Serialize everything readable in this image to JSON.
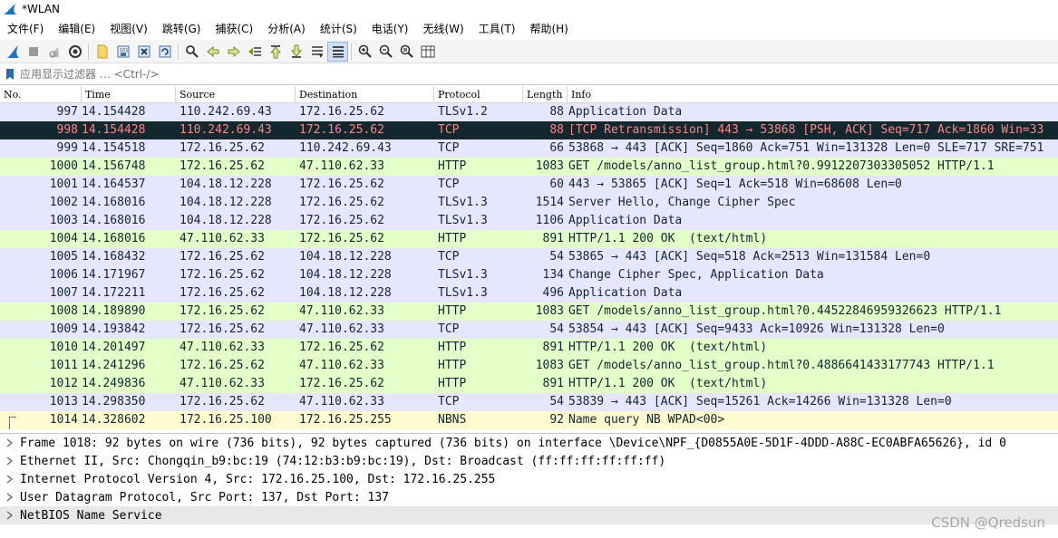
{
  "window": {
    "title": "*WLAN"
  },
  "menu": [
    "文件(F)",
    "编辑(E)",
    "视图(V)",
    "跳转(G)",
    "捕获(C)",
    "分析(A)",
    "统计(S)",
    "电话(Y)",
    "无线(W)",
    "工具(T)",
    "帮助(H)"
  ],
  "toolbar": {
    "icons": [
      "start-capture-icon",
      "stop-capture-icon",
      "restart-capture-icon",
      "capture-options-icon",
      "open-file-icon",
      "save-file-icon",
      "close-file-icon",
      "reload-file-icon",
      "find-packet-icon",
      "go-back-icon",
      "go-forward-icon",
      "go-to-packet-icon",
      "go-first-icon",
      "go-last-icon",
      "auto-scroll-icon",
      "colorize-icon",
      "zoom-in-icon",
      "zoom-out-icon",
      "normal-size-icon",
      "resize-columns-icon"
    ]
  },
  "filter": {
    "placeholder": "应用显示过滤器 … <Ctrl-/>"
  },
  "packet_list": {
    "columns": {
      "no": "No.",
      "time": "Time",
      "source": "Source",
      "destination": "Destination",
      "protocol": "Protocol",
      "length": "Length",
      "info": "Info"
    },
    "rows": [
      {
        "no": "997",
        "time": "14.154428",
        "source": "110.242.69.43",
        "destination": "172.16.25.62",
        "protocol": "TLSv1.2",
        "length": "88",
        "info": "Application Data",
        "bg": "#e7e6ff",
        "fg": "#12272e"
      },
      {
        "no": "998",
        "time": "14.154428",
        "source": "110.242.69.43",
        "destination": "172.16.25.62",
        "protocol": "TCP",
        "length": "88",
        "info": "[TCP Retransmission] 443 → 53868 [PSH, ACK] Seq=717 Ack=1860 Win=33",
        "bg": "#12272e",
        "fg": "#f78787"
      },
      {
        "no": "999",
        "time": "14.154518",
        "source": "172.16.25.62",
        "destination": "110.242.69.43",
        "protocol": "TCP",
        "length": "66",
        "info": "53868 → 443 [ACK] Seq=1860 Ack=751 Win=131328 Len=0 SLE=717 SRE=751",
        "bg": "#e7e6ff",
        "fg": "#12272e"
      },
      {
        "no": "1000",
        "time": "14.156748",
        "source": "172.16.25.62",
        "destination": "47.110.62.33",
        "protocol": "HTTP",
        "length": "1083",
        "info": "GET /models/anno_list_group.html?0.9912207303305052 HTTP/1.1",
        "bg": "#e4ffc7",
        "fg": "#12272e"
      },
      {
        "no": "1001",
        "time": "14.164537",
        "source": "104.18.12.228",
        "destination": "172.16.25.62",
        "protocol": "TCP",
        "length": "60",
        "info": "443 → 53865 [ACK] Seq=1 Ack=518 Win=68608 Len=0",
        "bg": "#e7e6ff",
        "fg": "#12272e"
      },
      {
        "no": "1002",
        "time": "14.168016",
        "source": "104.18.12.228",
        "destination": "172.16.25.62",
        "protocol": "TLSv1.3",
        "length": "1514",
        "info": "Server Hello, Change Cipher Spec",
        "bg": "#e7e6ff",
        "fg": "#12272e"
      },
      {
        "no": "1003",
        "time": "14.168016",
        "source": "104.18.12.228",
        "destination": "172.16.25.62",
        "protocol": "TLSv1.3",
        "length": "1106",
        "info": "Application Data",
        "bg": "#e7e6ff",
        "fg": "#12272e"
      },
      {
        "no": "1004",
        "time": "14.168016",
        "source": "47.110.62.33",
        "destination": "172.16.25.62",
        "protocol": "HTTP",
        "length": "891",
        "info": "HTTP/1.1 200 OK  (text/html)",
        "bg": "#e4ffc7",
        "fg": "#12272e"
      },
      {
        "no": "1005",
        "time": "14.168432",
        "source": "172.16.25.62",
        "destination": "104.18.12.228",
        "protocol": "TCP",
        "length": "54",
        "info": "53865 → 443 [ACK] Seq=518 Ack=2513 Win=131584 Len=0",
        "bg": "#e7e6ff",
        "fg": "#12272e"
      },
      {
        "no": "1006",
        "time": "14.171967",
        "source": "172.16.25.62",
        "destination": "104.18.12.228",
        "protocol": "TLSv1.3",
        "length": "134",
        "info": "Change Cipher Spec, Application Data",
        "bg": "#e7e6ff",
        "fg": "#12272e"
      },
      {
        "no": "1007",
        "time": "14.172211",
        "source": "172.16.25.62",
        "destination": "104.18.12.228",
        "protocol": "TLSv1.3",
        "length": "496",
        "info": "Application Data",
        "bg": "#e7e6ff",
        "fg": "#12272e"
      },
      {
        "no": "1008",
        "time": "14.189890",
        "source": "172.16.25.62",
        "destination": "47.110.62.33",
        "protocol": "HTTP",
        "length": "1083",
        "info": "GET /models/anno_list_group.html?0.44522846959326623 HTTP/1.1",
        "bg": "#e4ffc7",
        "fg": "#12272e"
      },
      {
        "no": "1009",
        "time": "14.193842",
        "source": "172.16.25.62",
        "destination": "47.110.62.33",
        "protocol": "TCP",
        "length": "54",
        "info": "53854 → 443 [ACK] Seq=9433 Ack=10926 Win=131328 Len=0",
        "bg": "#e7e6ff",
        "fg": "#12272e"
      },
      {
        "no": "1010",
        "time": "14.201497",
        "source": "47.110.62.33",
        "destination": "172.16.25.62",
        "protocol": "HTTP",
        "length": "891",
        "info": "HTTP/1.1 200 OK  (text/html)",
        "bg": "#e4ffc7",
        "fg": "#12272e"
      },
      {
        "no": "1011",
        "time": "14.241296",
        "source": "172.16.25.62",
        "destination": "47.110.62.33",
        "protocol": "HTTP",
        "length": "1083",
        "info": "GET /models/anno_list_group.html?0.4886641433177743 HTTP/1.1",
        "bg": "#e4ffc7",
        "fg": "#12272e"
      },
      {
        "no": "1012",
        "time": "14.249836",
        "source": "47.110.62.33",
        "destination": "172.16.25.62",
        "protocol": "HTTP",
        "length": "891",
        "info": "HTTP/1.1 200 OK  (text/html)",
        "bg": "#e4ffc7",
        "fg": "#12272e"
      },
      {
        "no": "1013",
        "time": "14.298350",
        "source": "172.16.25.62",
        "destination": "47.110.62.33",
        "protocol": "TCP",
        "length": "54",
        "info": "53839 → 443 [ACK] Seq=15261 Ack=14266 Win=131328 Len=0",
        "bg": "#e7e6ff",
        "fg": "#12272e"
      },
      {
        "no": "1014",
        "time": "14.328602",
        "source": "172.16.25.100",
        "destination": "172.16.25.255",
        "protocol": "NBNS",
        "length": "92",
        "info": "Name query NB WPAD<00>",
        "bg": "#fefbd0",
        "fg": "#12272e"
      }
    ]
  },
  "details": [
    "Frame 1018: 92 bytes on wire (736 bits), 92 bytes captured (736 bits) on interface \\Device\\NPF_{D0855A0E-5D1F-4DDD-A88C-EC0ABFA65626}, id 0",
    "Ethernet II, Src: Chongqin_b9:bc:19 (74:12:b3:b9:bc:19), Dst: Broadcast (ff:ff:ff:ff:ff:ff)",
    "Internet Protocol Version 4, Src: 172.16.25.100, Dst: 172.16.25.255",
    "User Datagram Protocol, Src Port: 137, Dst Port: 137",
    "NetBIOS Name Service"
  ],
  "watermark": "CSDN @Qredsun",
  "colors": {
    "tcp_bg": "#e7e6ff",
    "http_bg": "#e4ffc7",
    "nbns_bg": "#fefbd0",
    "bad_bg": "#12272e",
    "bad_fg": "#f78787"
  }
}
